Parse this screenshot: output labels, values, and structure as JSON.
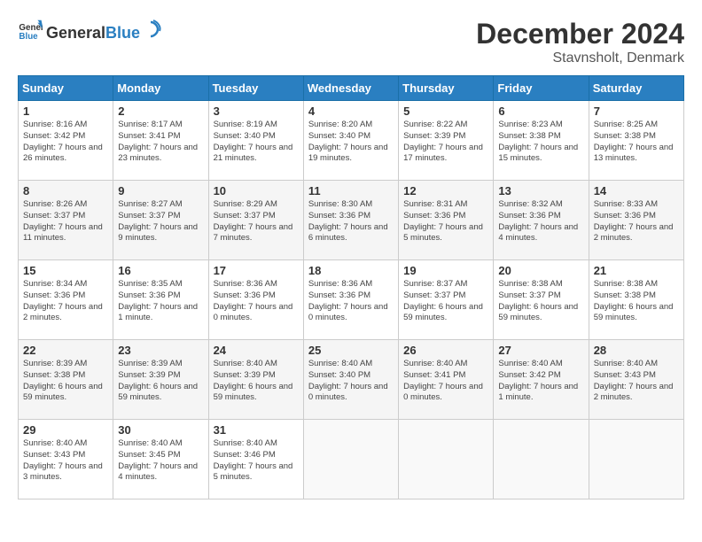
{
  "header": {
    "logo_general": "General",
    "logo_blue": "Blue",
    "month": "December 2024",
    "location": "Stavnsholt, Denmark"
  },
  "days_of_week": [
    "Sunday",
    "Monday",
    "Tuesday",
    "Wednesday",
    "Thursday",
    "Friday",
    "Saturday"
  ],
  "weeks": [
    [
      {
        "day": "1",
        "sunrise": "Sunrise: 8:16 AM",
        "sunset": "Sunset: 3:42 PM",
        "daylight": "Daylight: 7 hours and 26 minutes."
      },
      {
        "day": "2",
        "sunrise": "Sunrise: 8:17 AM",
        "sunset": "Sunset: 3:41 PM",
        "daylight": "Daylight: 7 hours and 23 minutes."
      },
      {
        "day": "3",
        "sunrise": "Sunrise: 8:19 AM",
        "sunset": "Sunset: 3:40 PM",
        "daylight": "Daylight: 7 hours and 21 minutes."
      },
      {
        "day": "4",
        "sunrise": "Sunrise: 8:20 AM",
        "sunset": "Sunset: 3:40 PM",
        "daylight": "Daylight: 7 hours and 19 minutes."
      },
      {
        "day": "5",
        "sunrise": "Sunrise: 8:22 AM",
        "sunset": "Sunset: 3:39 PM",
        "daylight": "Daylight: 7 hours and 17 minutes."
      },
      {
        "day": "6",
        "sunrise": "Sunrise: 8:23 AM",
        "sunset": "Sunset: 3:38 PM",
        "daylight": "Daylight: 7 hours and 15 minutes."
      },
      {
        "day": "7",
        "sunrise": "Sunrise: 8:25 AM",
        "sunset": "Sunset: 3:38 PM",
        "daylight": "Daylight: 7 hours and 13 minutes."
      }
    ],
    [
      {
        "day": "8",
        "sunrise": "Sunrise: 8:26 AM",
        "sunset": "Sunset: 3:37 PM",
        "daylight": "Daylight: 7 hours and 11 minutes."
      },
      {
        "day": "9",
        "sunrise": "Sunrise: 8:27 AM",
        "sunset": "Sunset: 3:37 PM",
        "daylight": "Daylight: 7 hours and 9 minutes."
      },
      {
        "day": "10",
        "sunrise": "Sunrise: 8:29 AM",
        "sunset": "Sunset: 3:37 PM",
        "daylight": "Daylight: 7 hours and 7 minutes."
      },
      {
        "day": "11",
        "sunrise": "Sunrise: 8:30 AM",
        "sunset": "Sunset: 3:36 PM",
        "daylight": "Daylight: 7 hours and 6 minutes."
      },
      {
        "day": "12",
        "sunrise": "Sunrise: 8:31 AM",
        "sunset": "Sunset: 3:36 PM",
        "daylight": "Daylight: 7 hours and 5 minutes."
      },
      {
        "day": "13",
        "sunrise": "Sunrise: 8:32 AM",
        "sunset": "Sunset: 3:36 PM",
        "daylight": "Daylight: 7 hours and 4 minutes."
      },
      {
        "day": "14",
        "sunrise": "Sunrise: 8:33 AM",
        "sunset": "Sunset: 3:36 PM",
        "daylight": "Daylight: 7 hours and 2 minutes."
      }
    ],
    [
      {
        "day": "15",
        "sunrise": "Sunrise: 8:34 AM",
        "sunset": "Sunset: 3:36 PM",
        "daylight": "Daylight: 7 hours and 2 minutes."
      },
      {
        "day": "16",
        "sunrise": "Sunrise: 8:35 AM",
        "sunset": "Sunset: 3:36 PM",
        "daylight": "Daylight: 7 hours and 1 minute."
      },
      {
        "day": "17",
        "sunrise": "Sunrise: 8:36 AM",
        "sunset": "Sunset: 3:36 PM",
        "daylight": "Daylight: 7 hours and 0 minutes."
      },
      {
        "day": "18",
        "sunrise": "Sunrise: 8:36 AM",
        "sunset": "Sunset: 3:36 PM",
        "daylight": "Daylight: 7 hours and 0 minutes."
      },
      {
        "day": "19",
        "sunrise": "Sunrise: 8:37 AM",
        "sunset": "Sunset: 3:37 PM",
        "daylight": "Daylight: 6 hours and 59 minutes."
      },
      {
        "day": "20",
        "sunrise": "Sunrise: 8:38 AM",
        "sunset": "Sunset: 3:37 PM",
        "daylight": "Daylight: 6 hours and 59 minutes."
      },
      {
        "day": "21",
        "sunrise": "Sunrise: 8:38 AM",
        "sunset": "Sunset: 3:38 PM",
        "daylight": "Daylight: 6 hours and 59 minutes."
      }
    ],
    [
      {
        "day": "22",
        "sunrise": "Sunrise: 8:39 AM",
        "sunset": "Sunset: 3:38 PM",
        "daylight": "Daylight: 6 hours and 59 minutes."
      },
      {
        "day": "23",
        "sunrise": "Sunrise: 8:39 AM",
        "sunset": "Sunset: 3:39 PM",
        "daylight": "Daylight: 6 hours and 59 minutes."
      },
      {
        "day": "24",
        "sunrise": "Sunrise: 8:40 AM",
        "sunset": "Sunset: 3:39 PM",
        "daylight": "Daylight: 6 hours and 59 minutes."
      },
      {
        "day": "25",
        "sunrise": "Sunrise: 8:40 AM",
        "sunset": "Sunset: 3:40 PM",
        "daylight": "Daylight: 7 hours and 0 minutes."
      },
      {
        "day": "26",
        "sunrise": "Sunrise: 8:40 AM",
        "sunset": "Sunset: 3:41 PM",
        "daylight": "Daylight: 7 hours and 0 minutes."
      },
      {
        "day": "27",
        "sunrise": "Sunrise: 8:40 AM",
        "sunset": "Sunset: 3:42 PM",
        "daylight": "Daylight: 7 hours and 1 minute."
      },
      {
        "day": "28",
        "sunrise": "Sunrise: 8:40 AM",
        "sunset": "Sunset: 3:43 PM",
        "daylight": "Daylight: 7 hours and 2 minutes."
      }
    ],
    [
      {
        "day": "29",
        "sunrise": "Sunrise: 8:40 AM",
        "sunset": "Sunset: 3:43 PM",
        "daylight": "Daylight: 7 hours and 3 minutes."
      },
      {
        "day": "30",
        "sunrise": "Sunrise: 8:40 AM",
        "sunset": "Sunset: 3:45 PM",
        "daylight": "Daylight: 7 hours and 4 minutes."
      },
      {
        "day": "31",
        "sunrise": "Sunrise: 8:40 AM",
        "sunset": "Sunset: 3:46 PM",
        "daylight": "Daylight: 7 hours and 5 minutes."
      },
      null,
      null,
      null,
      null
    ]
  ]
}
